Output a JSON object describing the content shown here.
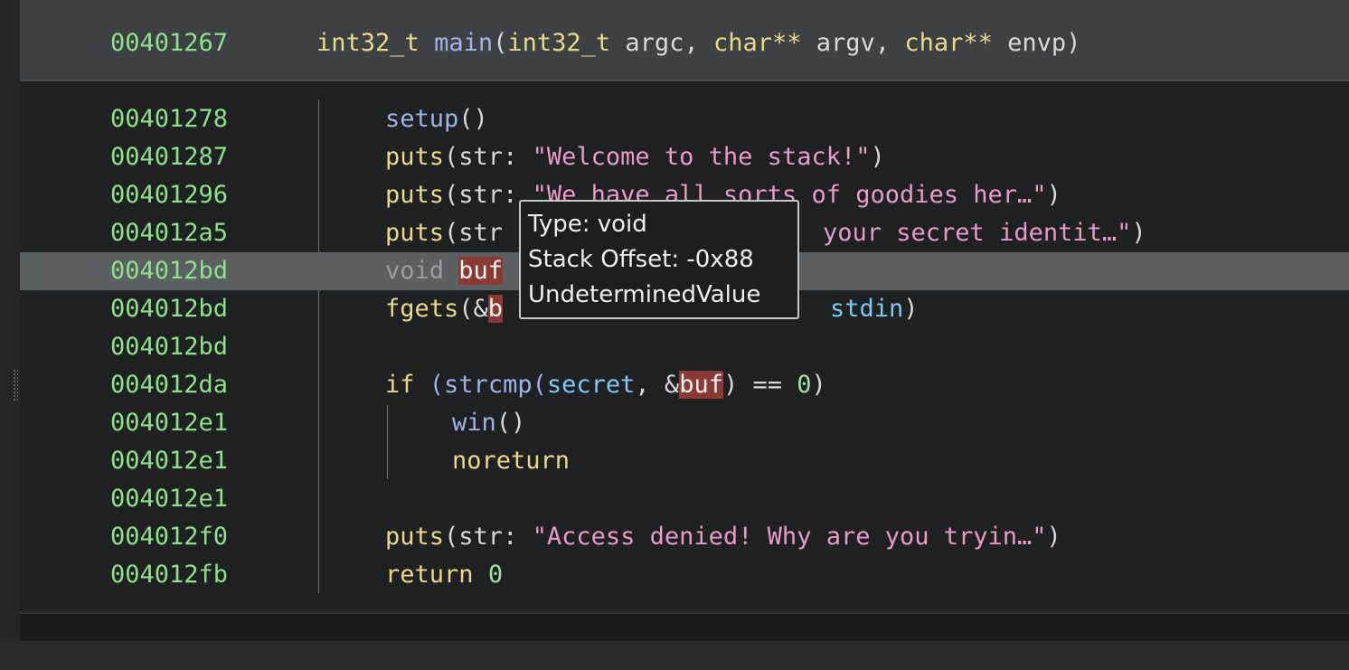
{
  "header": {
    "address": "00401267",
    "return_type": "int32_t",
    "function_name": "main",
    "params": [
      {
        "type": "int32_t",
        "name": "argc"
      },
      {
        "type": "char**",
        "name": "argv"
      },
      {
        "type": "char**",
        "name": "envp"
      }
    ]
  },
  "lines": [
    {
      "address": "00401278",
      "text": "setup()"
    },
    {
      "address": "00401287",
      "text": "puts(str: \"Welcome to the stack!\")"
    },
    {
      "address": "00401296",
      "text": "puts(str: \"We have all sorts of goodies her…\")"
    },
    {
      "address": "004012a5",
      "text": "puts(str: \"your secret identit…\")"
    },
    {
      "address": "004012bd",
      "text": "void buf"
    },
    {
      "address": "004012bd",
      "text": "fgets(&buf, stdin)"
    },
    {
      "address": "004012bd",
      "text": ""
    },
    {
      "address": "004012da",
      "text": "if (strcmp(secret, &buf) == 0)"
    },
    {
      "address": "004012e1",
      "text": "win()"
    },
    {
      "address": "004012e1",
      "text": "noreturn"
    },
    {
      "address": "004012e1",
      "text": ""
    },
    {
      "address": "004012f0",
      "text": "puts(str: \"Access denied! Why are you tryin…\")"
    },
    {
      "address": "004012fb",
      "text": "return 0"
    }
  ],
  "tokens": {
    "setup": "setup",
    "puts": "puts",
    "str_param": "str",
    "welcome": "\"Welcome to the stack!\"",
    "goodies": "\"We have all sorts of goodies her…\"",
    "secret_identity": "your secret identit…\"",
    "void": "void",
    "buf": "buf",
    "fgets": "fgets",
    "stdin": "stdin",
    "if": "if",
    "strcmp": "strcmp",
    "secret": "secret",
    "zero": "0",
    "win": "win",
    "noreturn": "noreturn",
    "access_denied": "\"Access denied! Why are you tryin…\"",
    "return": "return"
  },
  "tooltip": {
    "type_line": "Type: void",
    "offset_line": "Stack Offset: -0x88",
    "value_line": "UndeterminedValue"
  },
  "selected_line_index": 4,
  "colors": {
    "address": "#8fe08a",
    "keyword": "#e8d88a",
    "function": "#9fb3e8",
    "string": "#e89ac8",
    "variable": "#7fc8f0",
    "highlight": "#8a3a34",
    "selected_row": "#5b6062"
  }
}
